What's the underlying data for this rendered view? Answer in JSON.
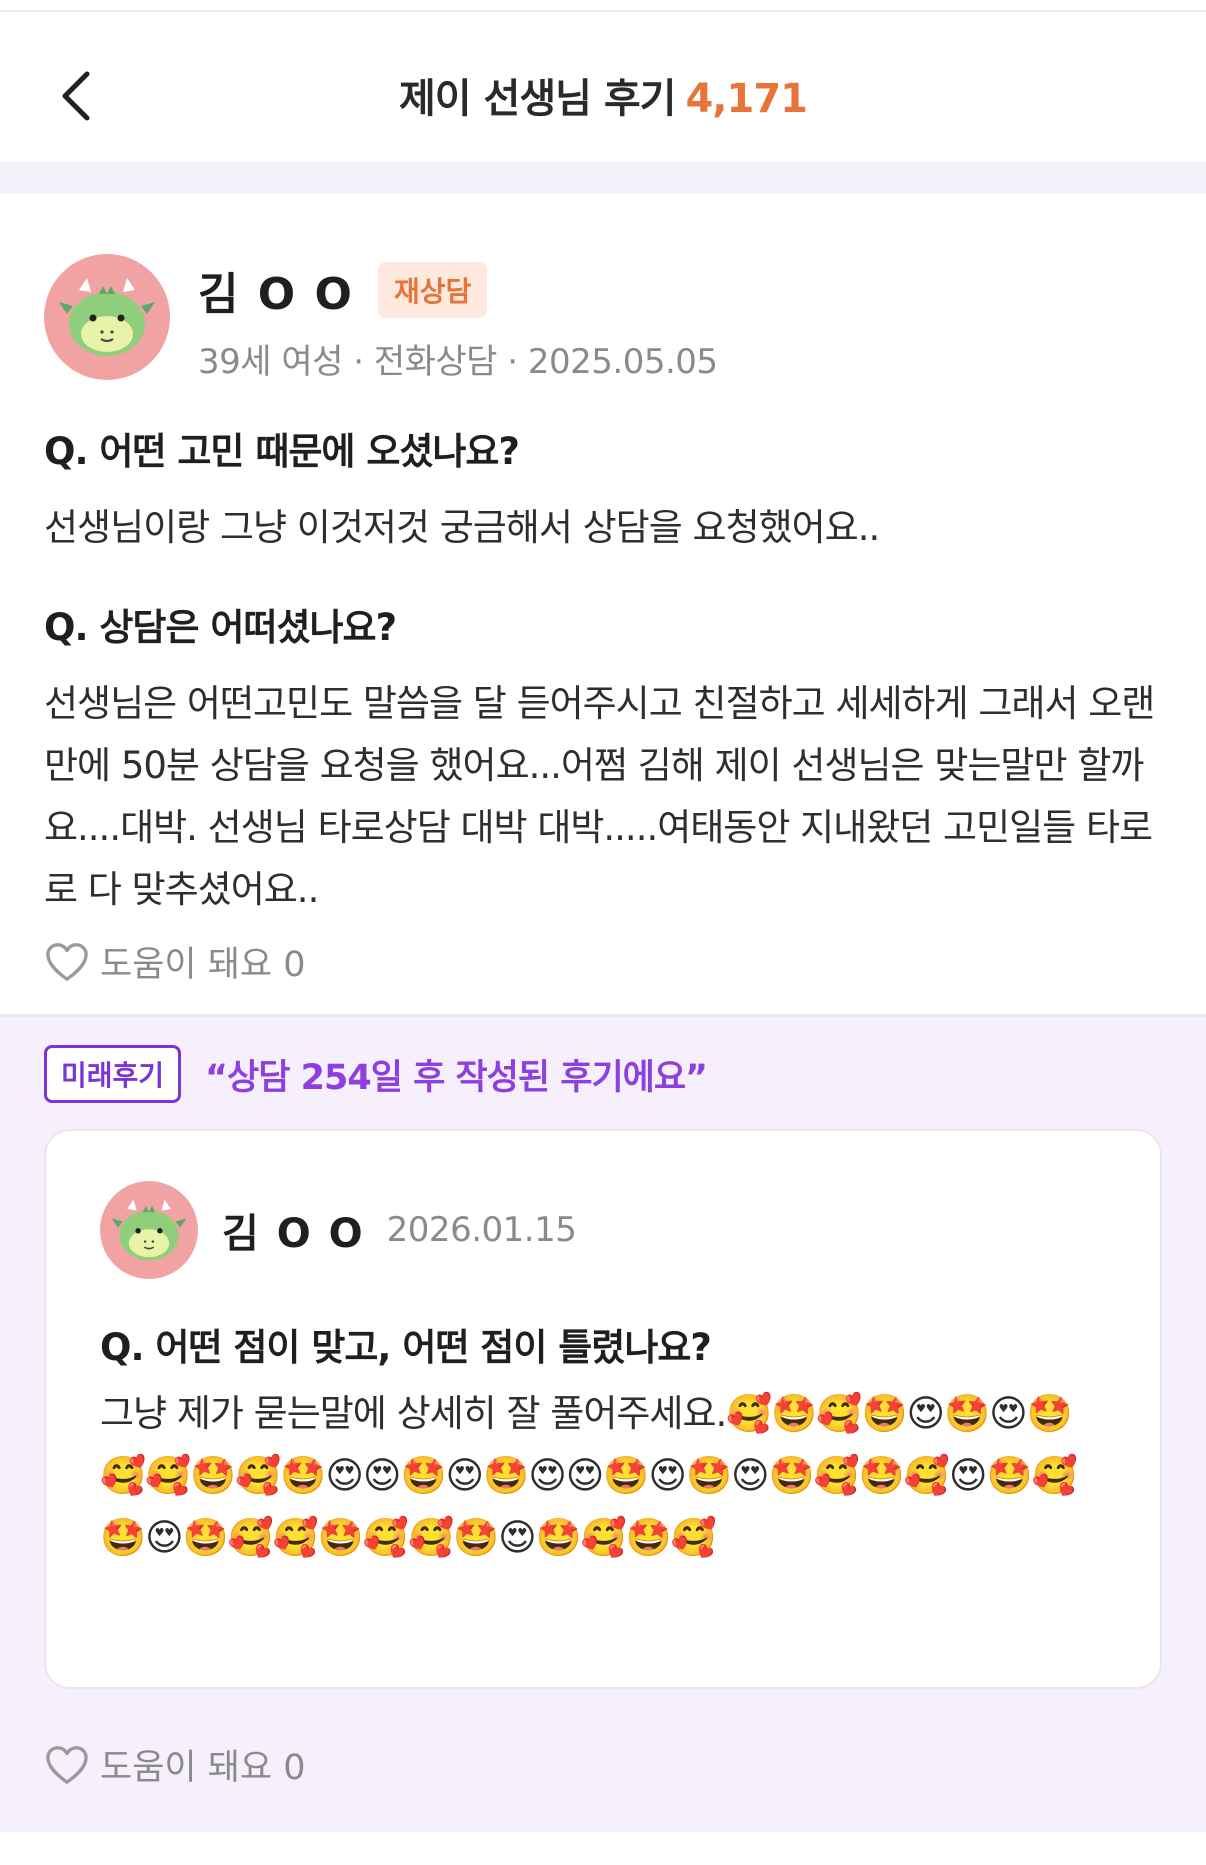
{
  "header": {
    "title": "제이 선생님 후기",
    "count": "4,171"
  },
  "review": {
    "author": "김 O O",
    "badge": "재상담",
    "meta": "39세 여성 · 전화상담 · 2025.05.05",
    "q1": "Q. 어떤 고민 때문에 오셨나요?",
    "a1": "선생님이랑 그냥 이것저것 궁금해서 상담을 요청했어요..",
    "q2": "Q. 상담은 어떠셨나요?",
    "a2": "선생님은 어떤고민도 말씀을 달 듣어주시고 친절하고 세세하게 그래서 오랜만에 50분 상담을 요청을 했어요...어쩜 김해 제이 선생님은 맞는말만 할까요....대박.  선생님 타로상담 대박 대박.....여태동안 지내왔던 고민일들 타로로 다 맞추셨어요..",
    "helpful": "도움이 돼요 0"
  },
  "future": {
    "tag": "미래후기",
    "quote": "“상담 254일 후 작성된 후기에요”",
    "author": "김 O O",
    "date": "2026.01.15",
    "q": "Q. 어떤 점이 맞고, 어떤 점이 틀렸나요?",
    "a": "그냥 제가 묻는말에 상세히 잘 풀어주세요.🥰🤩🥰🤩😍🤩😍🤩🥰🥰🤩🥰🤩😍😍🤩😍🤩😍😍🤩😍🤩😍🤩🥰🤩🥰😍🤩🥰🤩😍🤩🥰🥰🤩🥰🥰🤩😍🤩🥰🤩🥰",
    "helpful": "도움이 돼요 0"
  },
  "colors": {
    "accent_orange": "#e8743a",
    "accent_purple": "#7a35d6",
    "avatar_bg": "#f1a3a3"
  },
  "icons": [
    "chevron-left-icon",
    "dragon-avatar",
    "heart-outline-icon"
  ]
}
